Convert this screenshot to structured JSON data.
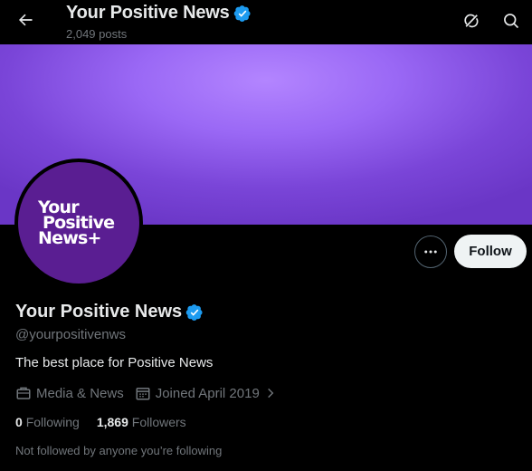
{
  "header": {
    "title": "Your Positive News",
    "posts_count": "2,049 posts",
    "back_icon": "arrow-left-icon",
    "grok_icon": "grok-icon",
    "search_icon": "search-icon"
  },
  "banner": {
    "color": "#9a68f5"
  },
  "avatar": {
    "logo_line1": "Your",
    "logo_line2": "Positive",
    "logo_line3": "News+",
    "bg_color": "#5a1e92"
  },
  "actions": {
    "more_icon": "more-icon",
    "follow_label": "Follow"
  },
  "profile": {
    "name": "Your Positive News",
    "verified_icon": "verified-badge-icon",
    "verified_color": "#1d9bf0",
    "handle": "@yourpositivenws",
    "bio": "The best place for Positive News",
    "category": "Media & News",
    "joined": "Joined April 2019",
    "following_count": "0",
    "following_label": "Following",
    "followers_count": "1,869",
    "followers_label": "Followers",
    "not_followed_text": "Not followed by anyone you’re following"
  }
}
